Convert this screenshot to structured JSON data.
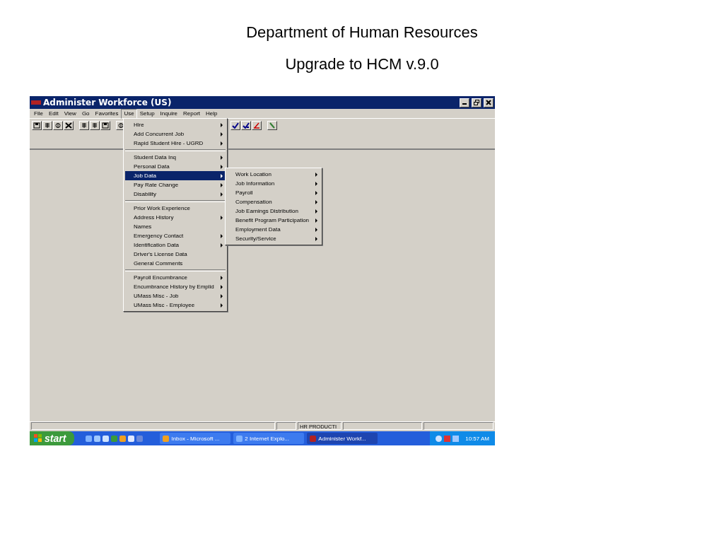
{
  "slide": {
    "title_lines": [
      "Department of Human Resources",
      "Upgrade to HCM v.9.0"
    ]
  },
  "window": {
    "title": "Administer Workforce (US)"
  },
  "menu_bar": [
    {
      "label": "File",
      "selected": false
    },
    {
      "label": "Edit",
      "selected": false
    },
    {
      "label": "View",
      "selected": false
    },
    {
      "label": "Go",
      "selected": false
    },
    {
      "label": "Favorites",
      "selected": false
    },
    {
      "label": "Use",
      "selected": true
    },
    {
      "label": "Setup",
      "selected": false
    },
    {
      "label": "Inquire",
      "selected": false
    },
    {
      "label": "Report",
      "selected": false
    },
    {
      "label": "Help",
      "selected": false
    }
  ],
  "use_menu": {
    "groups": [
      [
        {
          "label": "Hire",
          "submenu": true,
          "selected": false
        },
        {
          "label": "Add Concurrent Job",
          "submenu": true,
          "selected": false
        },
        {
          "label": "Rapid Student Hire - UGRD",
          "submenu": true,
          "selected": false
        }
      ],
      [
        {
          "label": "Student Data Inq",
          "submenu": true,
          "selected": false
        },
        {
          "label": "Personal Data",
          "submenu": true,
          "selected": false
        },
        {
          "label": "Job Data",
          "submenu": true,
          "selected": true
        },
        {
          "label": "Pay Rate Change",
          "submenu": true,
          "selected": false
        },
        {
          "label": "Disability",
          "submenu": true,
          "selected": false
        }
      ],
      [
        {
          "label": "Prior Work Experience",
          "submenu": false,
          "selected": false
        },
        {
          "label": "Address History",
          "submenu": true,
          "selected": false
        },
        {
          "label": "Names",
          "submenu": false,
          "selected": false
        },
        {
          "label": "Emergency Contact",
          "submenu": true,
          "selected": false
        },
        {
          "label": "Identification Data",
          "submenu": true,
          "selected": false
        },
        {
          "label": "Driver's License Data",
          "submenu": false,
          "selected": false
        },
        {
          "label": "General Comments",
          "submenu": false,
          "selected": false
        }
      ],
      [
        {
          "label": "Payroll Encumbrance",
          "submenu": true,
          "selected": false
        },
        {
          "label": "Encumbrance History by Emplid",
          "submenu": true,
          "selected": false
        },
        {
          "label": "UMass Misc - Job",
          "submenu": true,
          "selected": false
        },
        {
          "label": "UMass Misc  - Employee",
          "submenu": true,
          "selected": false
        }
      ]
    ]
  },
  "job_data_submenu": [
    {
      "label": "Work Location",
      "submenu": true,
      "selected": false
    },
    {
      "label": "Job Information",
      "submenu": true,
      "selected": false
    },
    {
      "label": "Payroll",
      "submenu": true,
      "selected": false
    },
    {
      "label": "Compensation",
      "submenu": true,
      "selected": false
    },
    {
      "label": "Job Earnings Distribution",
      "submenu": true,
      "selected": false
    },
    {
      "label": "Benefit Program Participation",
      "submenu": true,
      "selected": false
    },
    {
      "label": "Employment Data",
      "submenu": true,
      "selected": false
    },
    {
      "label": "Security/Service",
      "submenu": true,
      "selected": false
    }
  ],
  "status_bar": {
    "database": "HR PRODUCTI"
  },
  "taskbar": {
    "start": "start",
    "tasks": [
      {
        "label": "Inbox - Microsoft ...",
        "selected": false
      },
      {
        "label": "2 Internet Explo...",
        "selected": false
      },
      {
        "label": "Administer Workf...",
        "selected": true
      }
    ],
    "clock": "10:57 AM"
  }
}
